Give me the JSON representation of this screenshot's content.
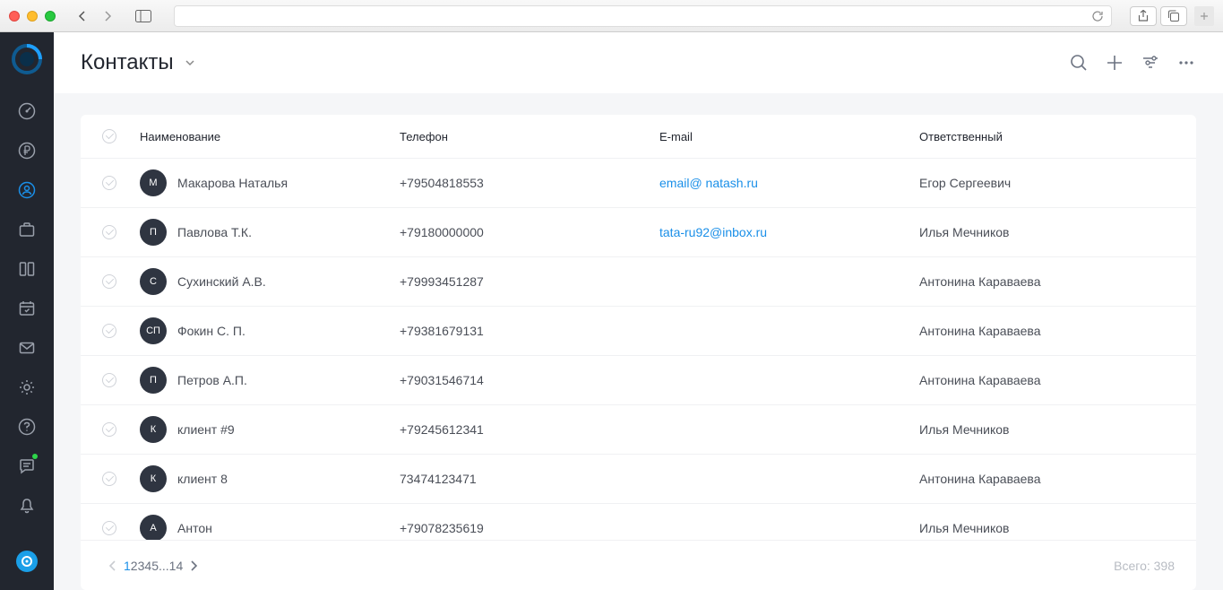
{
  "header": {
    "title": "Контакты"
  },
  "table": {
    "columns": {
      "name": "Наименование",
      "phone": "Телефон",
      "email": "E-mail",
      "owner": "Ответственный"
    },
    "rows": [
      {
        "initial": "М",
        "name": "Макарова Наталья",
        "phone": "+79504818553",
        "email": "email@ natash.ru",
        "owner": "Егор Сергеевич"
      },
      {
        "initial": "П",
        "name": "Павлова Т.К.",
        "phone": "+79180000000",
        "email": "tata-ru92@inbox.ru",
        "owner": "Илья Мечников"
      },
      {
        "initial": "С",
        "name": "Сухинский А.В.",
        "phone": "+79993451287",
        "email": "",
        "owner": "Антонина Караваева"
      },
      {
        "initial": "СП",
        "name": "Фокин С. П.",
        "phone": "+79381679131",
        "email": "",
        "owner": "Антонина Караваева"
      },
      {
        "initial": "П",
        "name": "Петров А.П.",
        "phone": "+79031546714",
        "email": "",
        "owner": "Антонина Караваева"
      },
      {
        "initial": "К",
        "name": "клиент #9",
        "phone": "+79245612341",
        "email": "",
        "owner": "Илья Мечников"
      },
      {
        "initial": "К",
        "name": "клиент 8",
        "phone": "73474123471",
        "email": "",
        "owner": "Антонина Караваева"
      },
      {
        "initial": "А",
        "name": "Антон",
        "phone": "+79078235619",
        "email": "",
        "owner": "Илья Мечников"
      }
    ]
  },
  "pagination": {
    "pages": [
      "1",
      "2",
      "3",
      "4",
      "5",
      "...",
      "14"
    ],
    "active": "1",
    "total_label": "Всего: 398"
  }
}
